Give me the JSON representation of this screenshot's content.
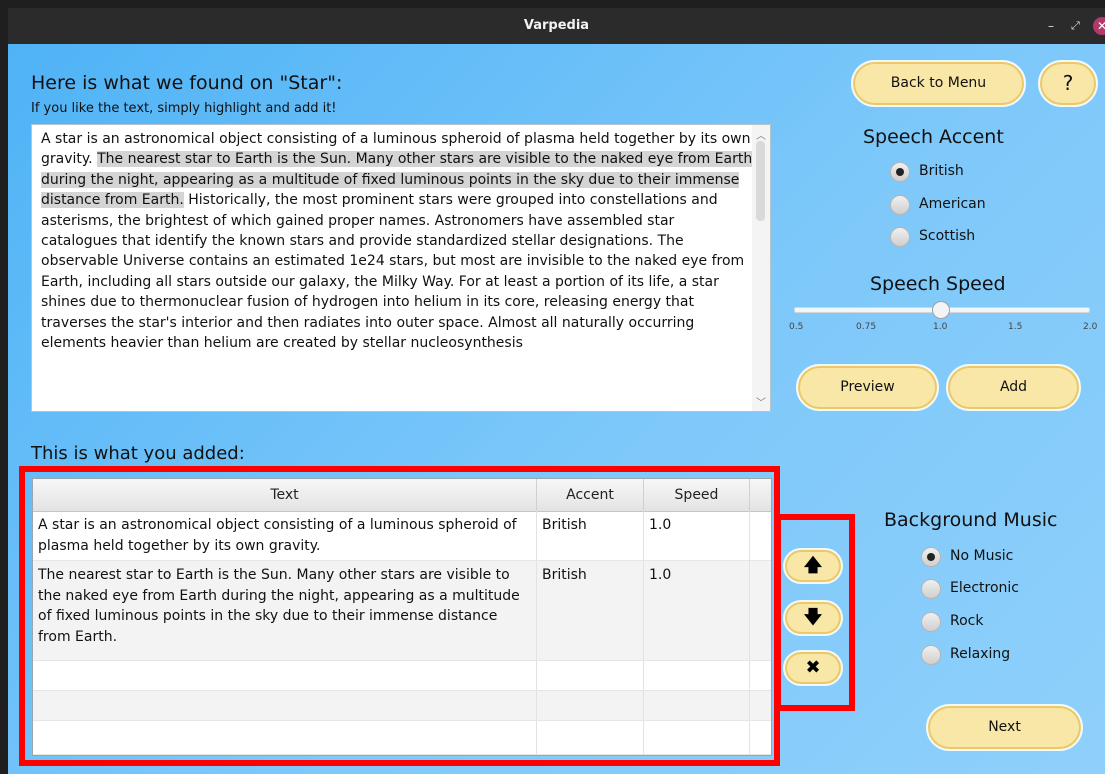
{
  "window": {
    "title": "Varpedia",
    "minimize": "–",
    "maximize": "⤢",
    "close": "✕"
  },
  "header": {
    "heading": "Here is what we found on \"Star\":",
    "subheading": "If you like the text, simply highlight and add it!"
  },
  "article": {
    "before_highlight": "A star is an astronomical object consisting of a luminous spheroid of plasma held together by its own gravity. ",
    "highlighted": "The nearest star to Earth is the Sun. Many other stars are visible to the naked eye from Earth during the night, appearing as a multitude of fixed luminous points in the sky due to their immense distance from Earth.",
    "after_highlight": " Historically, the most prominent stars were grouped into constellations and asterisms, the brightest of which gained proper names. Astronomers have assembled star catalogues that identify the known stars and provide standardized stellar designations. The observable Universe contains an estimated 1e24 stars, but most are invisible to the naked eye from Earth, including all stars outside our galaxy, the Milky Way. For at least a portion of its life, a star shines due to thermonuclear fusion of hydrogen into helium in its core, releasing energy that traverses the star's interior and then radiates into outer space. Almost all naturally occurring elements heavier than helium are created by stellar nucleosynthesis"
  },
  "added_title": "This is what you added:",
  "table": {
    "columns": [
      "Text",
      "Accent",
      "Speed"
    ],
    "rows": [
      {
        "text": "A star is an astronomical object consisting of a luminous spheroid of plasma held together by its own gravity.",
        "accent": "British",
        "speed": "1.0"
      },
      {
        "text": "The nearest star to Earth is the Sun. Many other stars are visible to the naked eye from Earth during the night, appearing as a multitude of fixed luminous points in the sky due to their immense distance from Earth.",
        "accent": "British",
        "speed": "1.0"
      }
    ]
  },
  "buttons": {
    "back": "Back to Menu",
    "help": "?",
    "preview": "Preview",
    "add": "Add",
    "next": "Next",
    "move_up": "🡅",
    "move_down": "🡇",
    "delete": "✖"
  },
  "speech_accent": {
    "label": "Speech Accent",
    "options": [
      "British",
      "American",
      "Scottish"
    ],
    "selected": "British"
  },
  "speech_speed": {
    "label": "Speech Speed",
    "ticks": [
      "0.5",
      "0.75",
      "1.0",
      "1.5",
      "2.0"
    ],
    "value": 1.0
  },
  "background_music": {
    "label": "Background Music",
    "options": [
      "No Music",
      "Electronic",
      "Rock",
      "Relaxing"
    ],
    "selected": "No Music"
  },
  "colors": {
    "button_fill": "#f8e7a6",
    "highlight_box": "#ff0000",
    "background_start": "#4fb3f6",
    "background_end": "#8fd0fb"
  }
}
